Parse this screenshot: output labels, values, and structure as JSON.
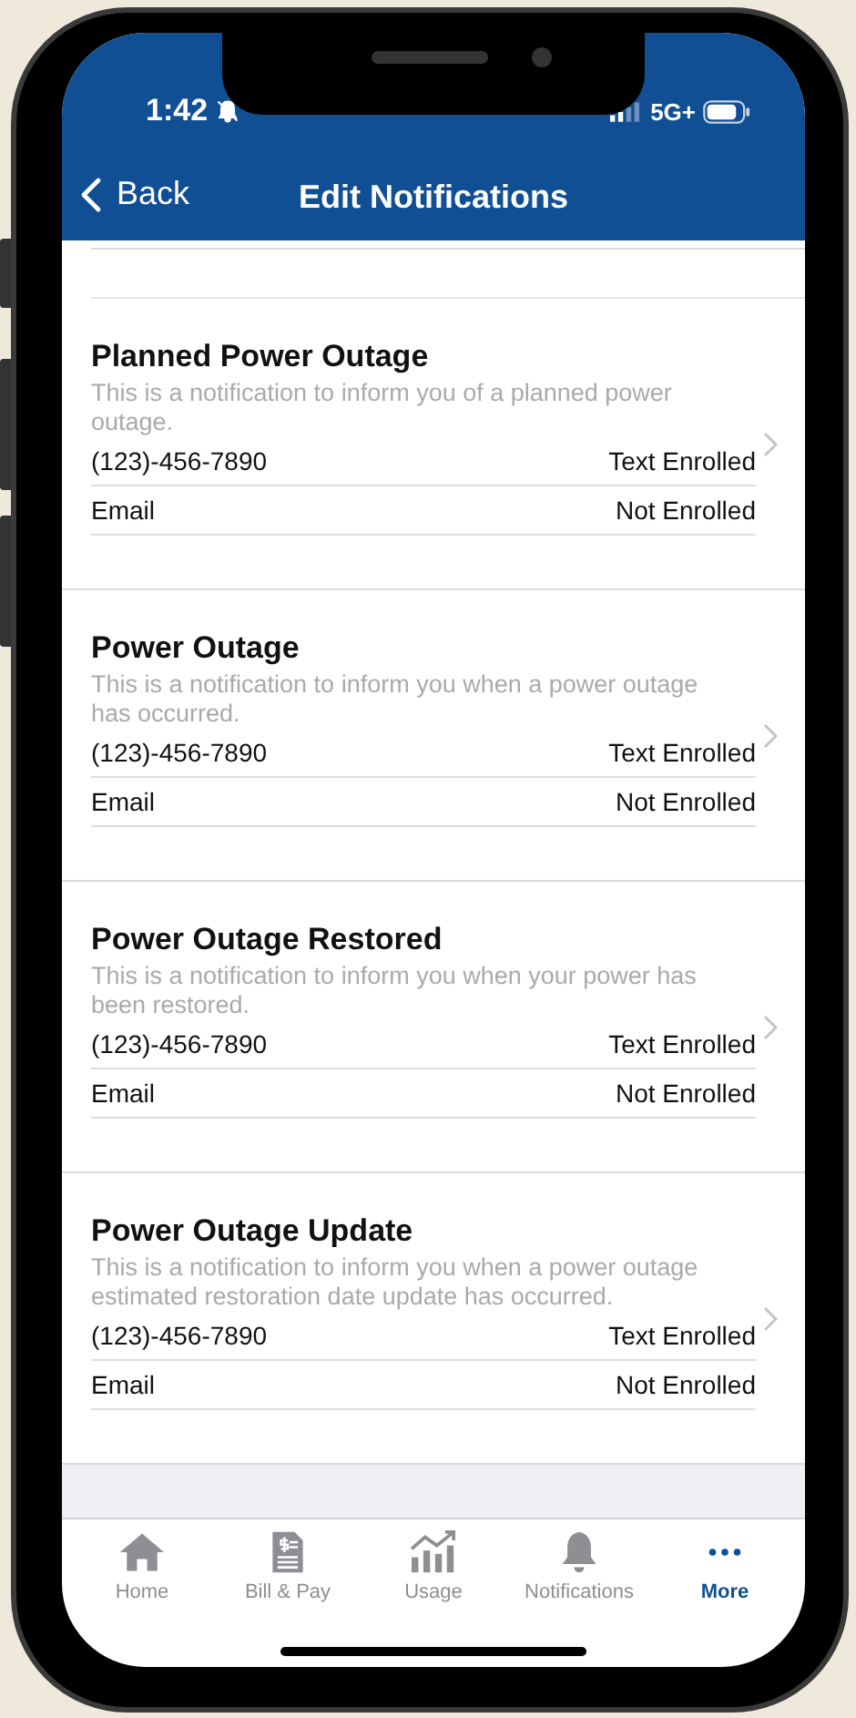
{
  "status_bar": {
    "time": "1:42",
    "network": "5G+"
  },
  "nav": {
    "back": "Back",
    "title": "Edit Notifications"
  },
  "sections": [
    {
      "title": "Planned Power Outage",
      "description": "This is a notification to inform you of a planned power outage.",
      "channels": [
        {
          "label": "(123)-456-7890",
          "status": "Text Enrolled"
        },
        {
          "label": "Email",
          "status": "Not Enrolled"
        }
      ]
    },
    {
      "title": "Power Outage",
      "description": "This is a notification to inform you when a power outage has occurred.",
      "channels": [
        {
          "label": "(123)-456-7890",
          "status": "Text Enrolled"
        },
        {
          "label": "Email",
          "status": "Not Enrolled"
        }
      ]
    },
    {
      "title": "Power Outage Restored",
      "description": "This is a notification to inform you when your power has been restored.",
      "channels": [
        {
          "label": "(123)-456-7890",
          "status": "Text Enrolled"
        },
        {
          "label": "Email",
          "status": "Not Enrolled"
        }
      ]
    },
    {
      "title": "Power Outage Update",
      "description": "This is a notification to inform you when a power outage estimated restoration date update has occurred.",
      "channels": [
        {
          "label": "(123)-456-7890",
          "status": "Text Enrolled"
        },
        {
          "label": "Email",
          "status": "Not Enrolled"
        }
      ]
    }
  ],
  "tab_bar": [
    {
      "kind": "home",
      "label": "Home",
      "selected": false
    },
    {
      "kind": "bill",
      "label": "Bill & Pay",
      "selected": false
    },
    {
      "kind": "usage",
      "label": "Usage",
      "selected": false
    },
    {
      "kind": "notifications",
      "label": "Notifications",
      "selected": false
    },
    {
      "kind": "more",
      "label": "More",
      "selected": true
    }
  ]
}
